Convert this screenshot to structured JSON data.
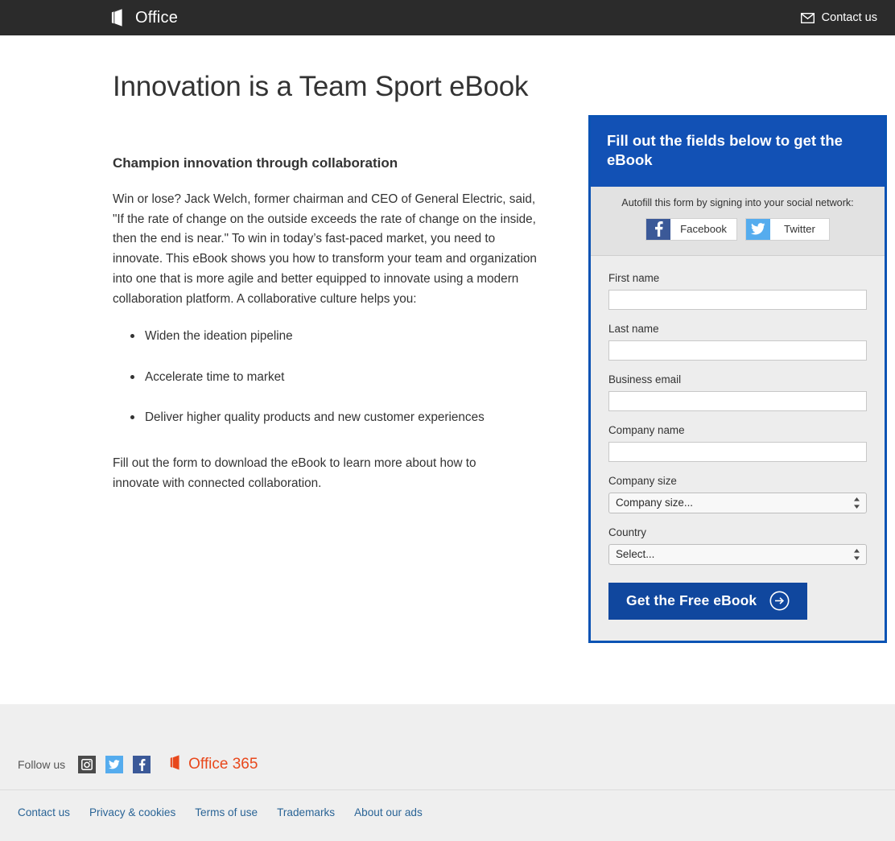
{
  "header": {
    "brand_label": "Office",
    "brand_icon": "office-logo-icon",
    "contact_label": "Contact us",
    "contact_icon": "envelope-icon",
    "background": "#2B2B2B"
  },
  "main": {
    "headline": "Innovation is a Team Sport eBook",
    "subheading": "Champion innovation through collaboration",
    "paragraph": "Win or lose? Jack Welch, former chairman and CEO of General Electric, said, \"If the rate of change on the outside exceeds the rate of change on the inside, then the end is near.\" To win in today’s fast-paced market, you need to innovate. This eBook shows you how to transform your team and organization into one that is more agile and better equipped to innovate using a modern collaboration platform. A collaborative culture helps you:",
    "bullets": [
      "Widen the ideation pipeline",
      "Accelerate time to market",
      "Deliver higher quality products and new customer experiences"
    ],
    "closing": "Fill out the form to download the eBook to learn more about how to innovate with connected collaboration."
  },
  "form": {
    "title": "Fill out the fields below to get the eBook",
    "accent_color": "#1251B5",
    "border_color": "#0A53B4",
    "autofill_prompt": "Autofill this form by signing into your social network:",
    "social_buttons": [
      {
        "label": "Facebook",
        "icon": "facebook-icon",
        "color": "#3B5998"
      },
      {
        "label": "Twitter",
        "icon": "twitter-icon",
        "color": "#55ACEE"
      }
    ],
    "fields": [
      {
        "label": "First name",
        "value": "",
        "placeholder": ""
      },
      {
        "label": "Last name",
        "value": "",
        "placeholder": ""
      },
      {
        "label": "Business email",
        "value": "",
        "placeholder": ""
      },
      {
        "label": "Company name",
        "value": "",
        "placeholder": ""
      }
    ],
    "selects": [
      {
        "label": "Company size",
        "selected": "Company size...",
        "options": [
          "Company size..."
        ]
      },
      {
        "label": "Country",
        "selected": "Select...",
        "options": [
          "Select..."
        ]
      }
    ],
    "submit_label": "Get the Free eBook",
    "submit_icon": "arrow-right-circle-icon",
    "submit_color": "#10479E"
  },
  "footer": {
    "follow_label": "Follow us",
    "social_icons": [
      {
        "name": "instagram-icon",
        "color": "#4B4B4B"
      },
      {
        "name": "twitter-icon",
        "color": "#55ACEE"
      },
      {
        "name": "facebook-icon",
        "color": "#3B5998"
      }
    ],
    "office365_label": "Office 365",
    "office365_icon": "office-logo-icon",
    "office365_color": "#E8481C",
    "links": [
      "Contact us",
      "Privacy & cookies",
      "Terms of use",
      "Trademarks",
      "About our ads"
    ],
    "background": "#EFEFEF"
  }
}
